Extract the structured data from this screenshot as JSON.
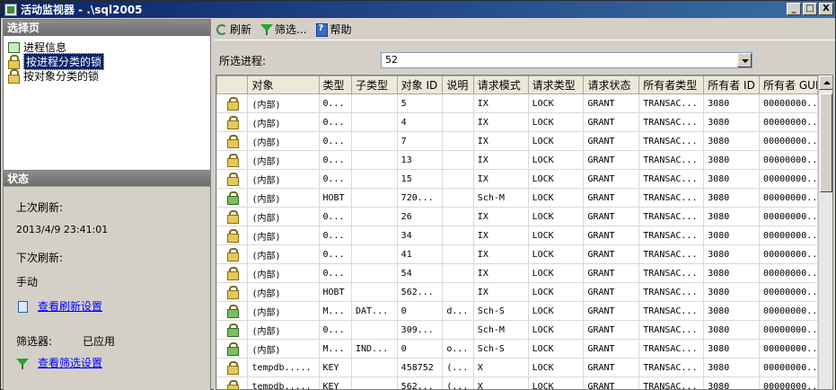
{
  "window": {
    "title": "活动监视器 - .\\sql2005",
    "min_label": "_",
    "max_label": "□",
    "close_label": "X"
  },
  "left": {
    "select_page_header": "选择页",
    "nav": [
      {
        "label": "进程信息",
        "icon": "process-icon"
      },
      {
        "label": "按进程分类的锁",
        "icon": "lock-icon"
      },
      {
        "label": "按对象分类的锁",
        "icon": "lock-icon"
      }
    ],
    "status_header": "状态",
    "last_refresh_label": "上次刷新:",
    "last_refresh_value": "2013/4/9 23:41:01",
    "next_refresh_label": "下次刷新:",
    "next_refresh_value": "手动",
    "view_refresh_settings": "查看刷新设置",
    "filter_label": "筛选器:",
    "filter_value": "已应用",
    "view_filter_settings": "查看筛选设置"
  },
  "toolbar": {
    "refresh": "刷新",
    "filter": "筛选...",
    "help": "帮助"
  },
  "process": {
    "label": "所选进程:",
    "value": "52"
  },
  "grid": {
    "headers": [
      "对象",
      "类型",
      "子类型",
      "对象 ID",
      "说明",
      "请求模式",
      "请求类型",
      "请求状态",
      "所有者类型",
      "所有者 ID",
      "所有者 GUID"
    ],
    "rows": [
      {
        "icon": "lock",
        "c": [
          "(内部)",
          "0...",
          "",
          "5",
          "",
          "IX",
          "LOCK",
          "GRANT",
          "TRANSAC...",
          "3080",
          "00000000..."
        ]
      },
      {
        "icon": "lock",
        "c": [
          "(内部)",
          "0...",
          "",
          "4",
          "",
          "IX",
          "LOCK",
          "GRANT",
          "TRANSAC...",
          "3080",
          "00000000..."
        ]
      },
      {
        "icon": "lock",
        "c": [
          "(内部)",
          "0...",
          "",
          "7",
          "",
          "IX",
          "LOCK",
          "GRANT",
          "TRANSAC...",
          "3080",
          "00000000..."
        ]
      },
      {
        "icon": "lock",
        "c": [
          "(内部)",
          "0...",
          "",
          "13",
          "",
          "IX",
          "LOCK",
          "GRANT",
          "TRANSAC...",
          "3080",
          "00000000..."
        ]
      },
      {
        "icon": "lock",
        "c": [
          "(内部)",
          "0...",
          "",
          "15",
          "",
          "IX",
          "LOCK",
          "GRANT",
          "TRANSAC...",
          "3080",
          "00000000..."
        ]
      },
      {
        "icon": "schema",
        "c": [
          "(内部)",
          "HOBT",
          "",
          "720...",
          "",
          "Sch-M",
          "LOCK",
          "GRANT",
          "TRANSAC...",
          "3080",
          "00000000..."
        ]
      },
      {
        "icon": "lock",
        "c": [
          "(内部)",
          "0...",
          "",
          "26",
          "",
          "IX",
          "LOCK",
          "GRANT",
          "TRANSAC...",
          "3080",
          "00000000..."
        ]
      },
      {
        "icon": "lock",
        "c": [
          "(内部)",
          "0...",
          "",
          "34",
          "",
          "IX",
          "LOCK",
          "GRANT",
          "TRANSAC...",
          "3080",
          "00000000..."
        ]
      },
      {
        "icon": "lock",
        "c": [
          "(内部)",
          "0...",
          "",
          "41",
          "",
          "IX",
          "LOCK",
          "GRANT",
          "TRANSAC...",
          "3080",
          "00000000..."
        ]
      },
      {
        "icon": "lock",
        "c": [
          "(内部)",
          "0...",
          "",
          "54",
          "",
          "IX",
          "LOCK",
          "GRANT",
          "TRANSAC...",
          "3080",
          "00000000..."
        ]
      },
      {
        "icon": "lock",
        "c": [
          "(内部)",
          "HOBT",
          "",
          "562...",
          "",
          "IX",
          "LOCK",
          "GRANT",
          "TRANSAC...",
          "3080",
          "00000000..."
        ]
      },
      {
        "icon": "schema",
        "c": [
          "(内部)",
          "M...",
          "DAT...",
          "0",
          "d...",
          "Sch-S",
          "LOCK",
          "GRANT",
          "TRANSAC...",
          "3080",
          "00000000..."
        ]
      },
      {
        "icon": "schema",
        "c": [
          "(内部)",
          "0...",
          "",
          "309...",
          "",
          "Sch-M",
          "LOCK",
          "GRANT",
          "TRANSAC...",
          "3080",
          "00000000..."
        ]
      },
      {
        "icon": "schema",
        "c": [
          "(内部)",
          "M...",
          "IND...",
          "0",
          "o...",
          "Sch-S",
          "LOCK",
          "GRANT",
          "TRANSAC...",
          "3080",
          "00000000..."
        ]
      },
      {
        "icon": "lock",
        "c": [
          "tempdb.....",
          "KEY",
          "",
          "458752",
          "(...",
          "X",
          "LOCK",
          "GRANT",
          "TRANSAC...",
          "3080",
          "00000000..."
        ]
      },
      {
        "icon": "lock",
        "c": [
          "tempdb.....",
          "KEY",
          "",
          "562...",
          "(...",
          "X",
          "LOCK",
          "GRANT",
          "TRANSAC...",
          "3080",
          "00000000..."
        ]
      }
    ]
  }
}
